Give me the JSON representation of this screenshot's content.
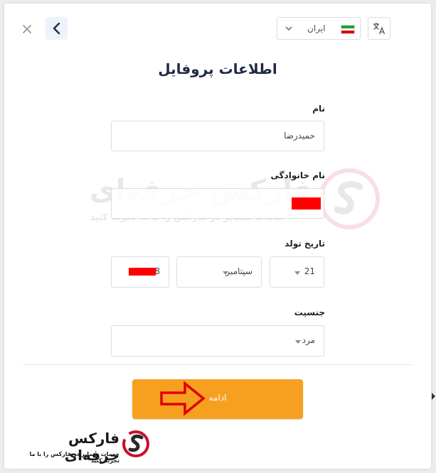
{
  "header": {
    "country_select": {
      "selected": "ایران",
      "flag_colors": [
        "#239f40",
        "#ffffff",
        "#da0000"
      ]
    }
  },
  "page_title": "اطلاعات پروفایل",
  "form": {
    "first_name": {
      "label": "نام",
      "value": "حمیدرضا"
    },
    "last_name": {
      "label": "نام خانوادگی",
      "value": ""
    },
    "birth_date": {
      "label": "تاریخ تولد",
      "day": "21",
      "month": "سپتامبر",
      "year": "8"
    },
    "gender": {
      "label": "جنسیت",
      "value": "مرد"
    }
  },
  "continue_button": {
    "label": "ادامه",
    "color": "#f7a020"
  },
  "watermark": {
    "name": "فارکس حرفه‌ای",
    "tagline": "خدمات متمایز در فارکس را با ما تجربه کنید"
  },
  "brand": {
    "name": "فارکس حرفه‌ای",
    "tagline": "خدمات متمایز در فارکس را با ما تجربه کنید",
    "accent": "#c8102e"
  },
  "colors": {
    "redaction": "#ff0000",
    "arrow": "#e00000"
  }
}
